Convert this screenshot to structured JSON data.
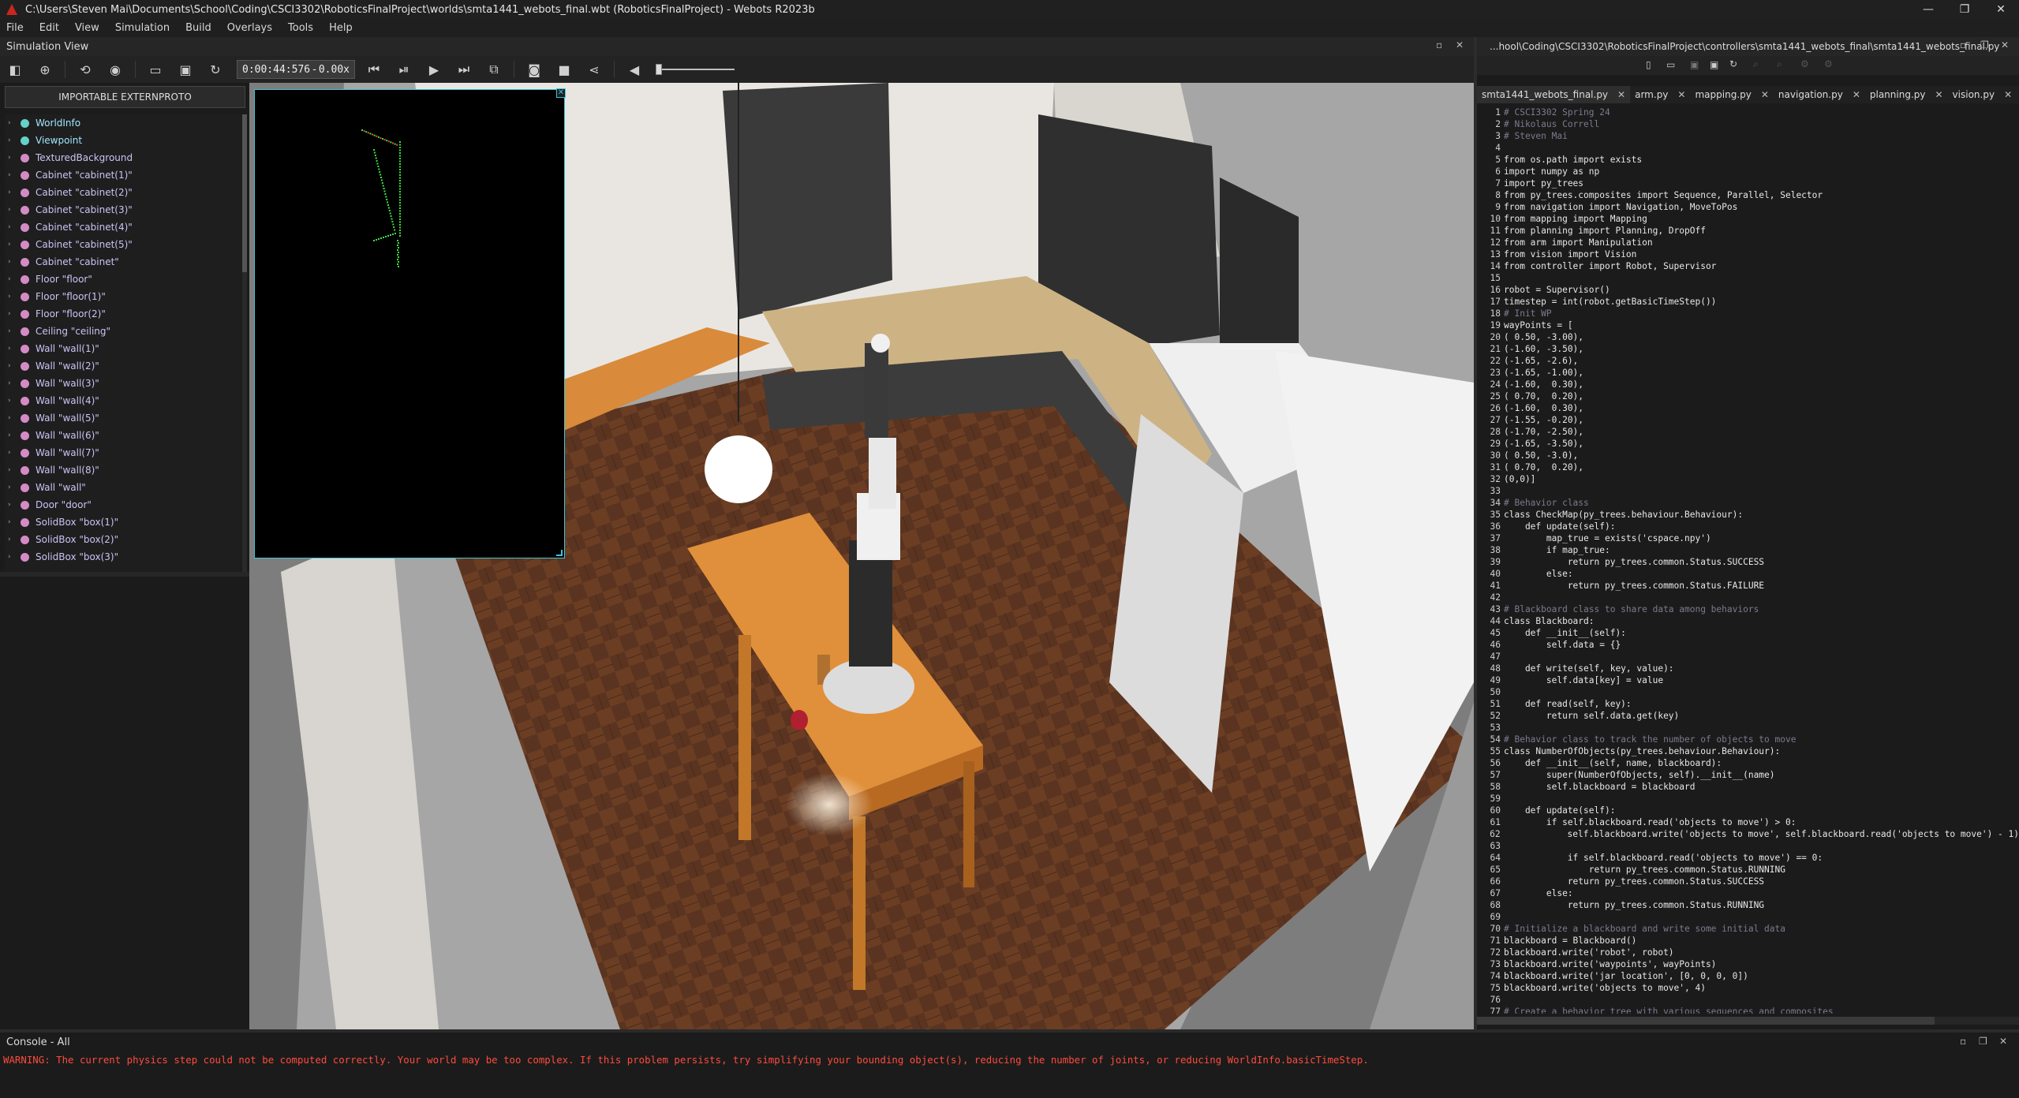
{
  "window": {
    "title": "C:\\Users\\Steven Mai\\Documents\\School\\Coding\\CSCI3302\\RoboticsFinalProject\\worlds\\smta1441_webots_final.wbt (RoboticsFinalProject) - Webots R2023b",
    "controls": [
      "—",
      "❐",
      "✕"
    ]
  },
  "menu": [
    "File",
    "Edit",
    "View",
    "Simulation",
    "Build",
    "Overlays",
    "Tools",
    "Help"
  ],
  "simulation_view": {
    "label": "Simulation View"
  },
  "toolbar": {
    "time": "0:00:44:576",
    "speed_dash": "-",
    "speed": "0.00x",
    "volume_level": 0.0
  },
  "scene_tree": {
    "import_label": "IMPORTABLE EXTERNPROTO",
    "items": [
      {
        "label": "WorldInfo",
        "special": true
      },
      {
        "label": "Viewpoint",
        "special": true
      },
      {
        "label": "TexturedBackground"
      },
      {
        "label": "Cabinet \"cabinet(1)\""
      },
      {
        "label": "Cabinet \"cabinet(2)\""
      },
      {
        "label": "Cabinet \"cabinet(3)\""
      },
      {
        "label": "Cabinet \"cabinet(4)\""
      },
      {
        "label": "Cabinet \"cabinet(5)\""
      },
      {
        "label": "Cabinet \"cabinet\""
      },
      {
        "label": "Floor \"floor\""
      },
      {
        "label": "Floor \"floor(1)\""
      },
      {
        "label": "Floor \"floor(2)\""
      },
      {
        "label": "Ceiling \"ceiling\""
      },
      {
        "label": "Wall \"wall(1)\""
      },
      {
        "label": "Wall \"wall(2)\""
      },
      {
        "label": "Wall \"wall(3)\""
      },
      {
        "label": "Wall \"wall(4)\""
      },
      {
        "label": "Wall \"wall(5)\""
      },
      {
        "label": "Wall \"wall(6)\""
      },
      {
        "label": "Wall \"wall(7)\""
      },
      {
        "label": "Wall \"wall(8)\""
      },
      {
        "label": "Wall \"wall\""
      },
      {
        "label": "Door \"door\""
      },
      {
        "label": "SolidBox \"box(1)\""
      },
      {
        "label": "SolidBox \"box(2)\""
      },
      {
        "label": "SolidBox \"box(3)\""
      }
    ]
  },
  "editor": {
    "path": "...hool\\Coding\\CSCI3302\\RoboticsFinalProject\\controllers\\smta1441_webots_final\\smta1441_webots_final.py",
    "tabs": [
      "smta1441_webots_final.py",
      "arm.py",
      "mapping.py",
      "navigation.py",
      "planning.py",
      "vision.py"
    ],
    "lines": [
      "# CSCI3302 Spring 24",
      "# Nikolaus Correll",
      "# Steven Mai",
      "",
      "from os.path import exists",
      "import numpy as np",
      "import py_trees",
      "from py_trees.composites import Sequence, Parallel, Selector",
      "from navigation import Navigation, MoveToPos",
      "from mapping import Mapping",
      "from planning import Planning, DropOff",
      "from arm import Manipulation",
      "from vision import Vision",
      "from controller import Robot, Supervisor",
      "",
      "robot = Supervisor()",
      "timestep = int(robot.getBasicTimeStep())",
      "# Init WP",
      "wayPoints = [",
      "( 0.50, -3.00),",
      "(-1.60, -3.50),",
      "(-1.65, -2.6),",
      "(-1.65, -1.00),",
      "(-1.60,  0.30),",
      "( 0.70,  0.20),",
      "(-1.60,  0.30),",
      "(-1.55, -0.20),",
      "(-1.70, -2.50),",
      "(-1.65, -3.50),",
      "( 0.50, -3.0),",
      "( 0.70,  0.20),",
      "(0,0)]",
      "",
      "# Behavior class",
      "class CheckMap(py_trees.behaviour.Behaviour):",
      "    def update(self):",
      "        map_true = exists('cspace.npy')",
      "        if map_true:",
      "            return py_trees.common.Status.SUCCESS",
      "        else:",
      "            return py_trees.common.Status.FAILURE",
      "",
      "# Blackboard class to share data among behaviors",
      "class Blackboard:",
      "    def __init__(self):",
      "        self.data = {}",
      "",
      "    def write(self, key, value):",
      "        self.data[key] = value",
      "",
      "    def read(self, key):",
      "        return self.data.get(key)",
      "",
      "# Behavior class to track the number of objects to move",
      "class NumberOfObjects(py_trees.behaviour.Behaviour):",
      "    def __init__(self, name, blackboard):",
      "        super(NumberOfObjects, self).__init__(name)",
      "        self.blackboard = blackboard",
      "",
      "    def update(self):",
      "        if self.blackboard.read('objects to move') > 0:",
      "            self.blackboard.write('objects to move', self.blackboard.read('objects to move') - 1)",
      "",
      "            if self.blackboard.read('objects to move') == 0:",
      "                return py_trees.common.Status.RUNNING",
      "            return py_trees.common.Status.SUCCESS",
      "        else:",
      "            return py_trees.common.Status.RUNNING",
      "",
      "# Initialize a blackboard and write some initial data",
      "blackboard = Blackboard()",
      "blackboard.write('robot', robot)",
      "blackboard.write('waypoints', wayPoints)",
      "blackboard.write('jar location', [0, 0, 0, 0])",
      "blackboard.write('objects to move', 4)",
      "",
      "# Create a behavior tree with various sequences and composites"
    ]
  },
  "console": {
    "title": "Console - All",
    "message": "WARNING: The current physics step could not be computed correctly. Your world may be too complex. If this problem persists, try simplifying your bounding object(s), reducing the number of joints, or reducing WorldInfo.basicTimeStep."
  },
  "colors": {
    "keyword": "#ff6fb0",
    "builtin": "#c77dff",
    "string": "#ff7ea0",
    "number": "#9ad2ff",
    "comment": "#7b7b8f",
    "warning": "#ff4b3c",
    "accent": "#40c4d8"
  }
}
